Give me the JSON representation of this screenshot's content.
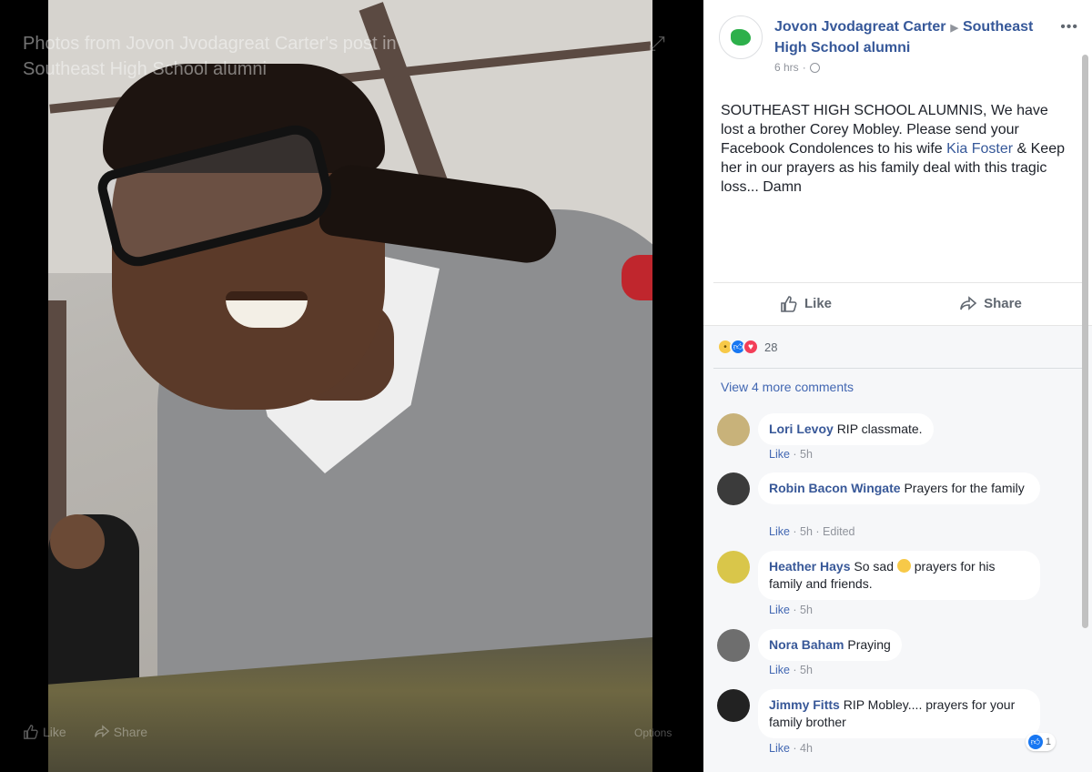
{
  "viewer": {
    "caption": "Photos from Jovon Jvodagreat Carter's post in Southeast High School alumni",
    "like_label": "Like",
    "share_label": "Share",
    "options_label": "Options"
  },
  "post": {
    "author": "Jovon Jvodagreat Carter",
    "group": "Southeast High School alumni",
    "time": "6 hrs",
    "text_before_link": "SOUTHEAST HIGH SCHOOL ALUMNIS, We have lost a brother Corey Mobley. Please send your Facebook Condolences to his wife ",
    "link_text": "Kia Foster",
    "text_after_link": " & Keep her in our prayers as his family deal with this tragic loss... Damn",
    "like_label": "Like",
    "share_label": "Share",
    "reaction_count": "28",
    "view_more": "View 4 more comments"
  },
  "comments": [
    {
      "name": "Lori Levoy",
      "text": "RIP classmate.",
      "meta_like": "Like",
      "meta_rest": " · 5h"
    },
    {
      "name": "Robin Bacon Wingate",
      "text": "Prayers for the family",
      "meta_like": "Like",
      "meta_rest": " · 5h · Edited"
    },
    {
      "name": "Heather Hays",
      "text_before": "So sad",
      "text_after": "prayers for his family and friends.",
      "meta_like": "Like",
      "meta_rest": " · 5h"
    },
    {
      "name": "Nora Baham",
      "text": "Praying",
      "meta_like": "Like",
      "meta_rest": " · 5h"
    },
    {
      "name": "Jimmy Fitts",
      "text": "RIP Mobley.... prayers for your family brother",
      "meta_like": "Like",
      "meta_rest": " · 4h",
      "reaction_count": "1"
    }
  ],
  "colors": {
    "link": "#365899",
    "accent": "#4267b2",
    "meta": "#90949c"
  }
}
